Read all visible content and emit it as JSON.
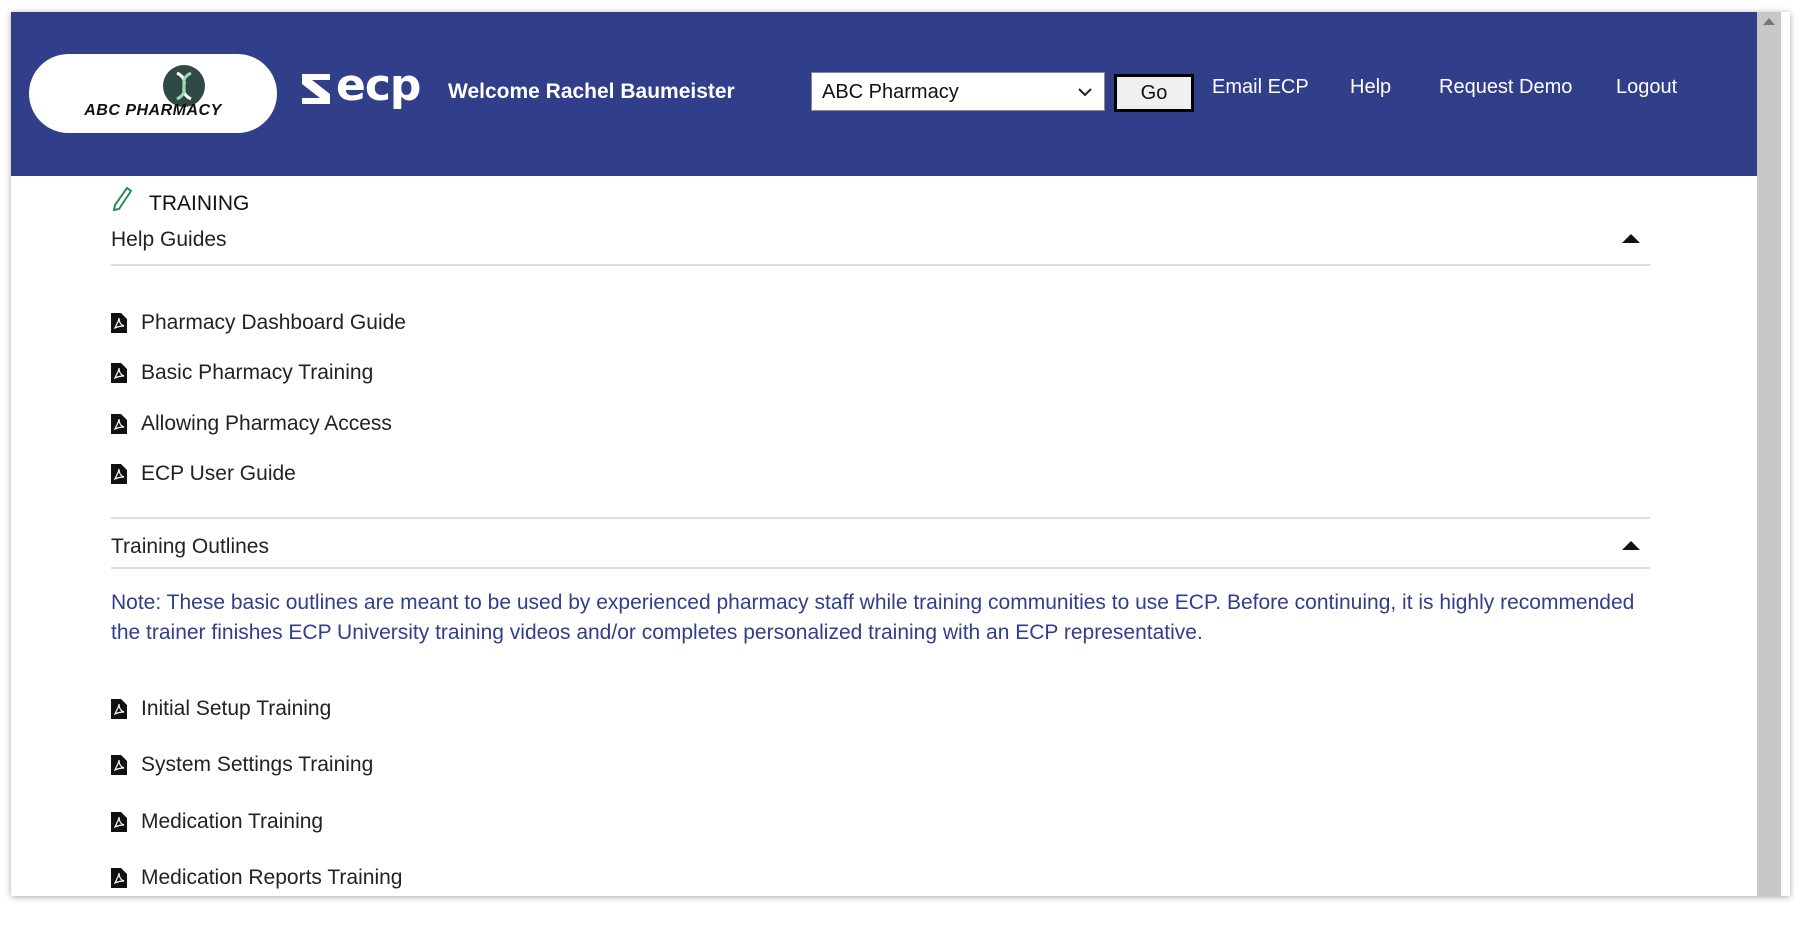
{
  "header": {
    "logo_text": "ABC PHARMACY",
    "brand": "ecp",
    "welcome": "Welcome Rachel Baumeister",
    "pharmacy_select": {
      "value": "ABC Pharmacy"
    },
    "go_label": "Go",
    "nav": [
      "Email ECP",
      "Help",
      "Request Demo",
      "Logout"
    ]
  },
  "page": {
    "title": "TRAINING"
  },
  "sections": {
    "help_guides": {
      "title": "Help Guides",
      "items": [
        "Pharmacy Dashboard Guide",
        "Basic Pharmacy Training",
        "Allowing Pharmacy Access",
        "ECP User Guide"
      ]
    },
    "training_outlines": {
      "title": "Training Outlines",
      "note": "Note: These basic outlines are meant to be used by experienced pharmacy staff while training communities to use ECP. Before continuing, it is highly recommended the trainer finishes ECP University training videos and/or completes personalized training with an ECP representative.",
      "items": [
        "Initial Setup Training",
        "System Settings Training",
        "Medication Training",
        "Medication Reports Training"
      ]
    }
  },
  "colors": {
    "header_bg": "#313e8a",
    "note_text": "#313e8a",
    "accent_green": "#2e8b57"
  },
  "icons": {
    "title": "pencil-icon",
    "document": "pdf-file-icon",
    "collapse": "caret-up-icon"
  }
}
